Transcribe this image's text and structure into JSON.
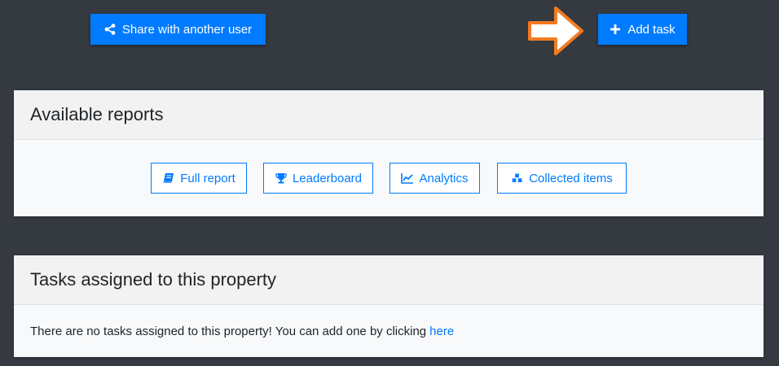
{
  "toolbar": {
    "share_label": "Share with another user",
    "add_task_label": "Add task"
  },
  "reports": {
    "title": "Available reports",
    "buttons": [
      {
        "label": "Full report",
        "icon": "book-icon"
      },
      {
        "label": "Leaderboard",
        "icon": "trophy-icon"
      },
      {
        "label": "Analytics",
        "icon": "line-chart-icon"
      },
      {
        "label": "Collected items",
        "icon": "cubes-icon"
      }
    ]
  },
  "tasks": {
    "title": "Tasks assigned to this property",
    "empty_text": "There are no tasks assigned to this property! You can add one by clicking",
    "link_label": "here"
  },
  "colors": {
    "background": "#343a40",
    "primary": "#007bff",
    "arrow_fill": "#ffffff",
    "arrow_stroke": "#f47b20"
  }
}
